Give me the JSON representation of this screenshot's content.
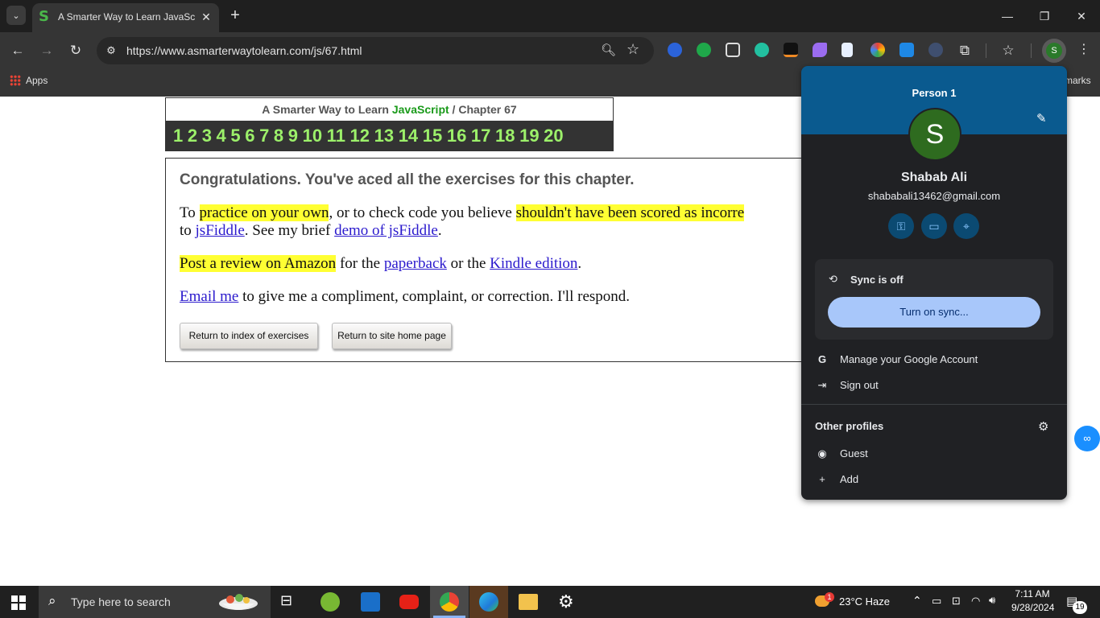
{
  "browser": {
    "tab_title": "A Smarter Way to Learn JavaScript",
    "tab_favicon": "S",
    "url": "https://www.asmarterwaytolearn.com/js/67.html",
    "bookmarks_apps": "Apps",
    "bookmarks_right": "marks",
    "profile_initial": "S"
  },
  "page": {
    "header_prefix": "A Smarter Way to Learn ",
    "header_js": "JavaScript",
    "header_suffix": "  /  Chapter 67",
    "chapters": [
      "1",
      "2",
      "3",
      "4",
      "5",
      "6",
      "7",
      "8",
      "9",
      "10",
      "11",
      "12",
      "13",
      "14",
      "15",
      "16",
      "17",
      "18",
      "19",
      "20"
    ],
    "congrats": "Congratulations. You've aced all the exercises for this chapter.",
    "p1_a": "To ",
    "p1_hl1": "practice on your own",
    "p1_b": ", or to check code you believe ",
    "p1_hl2": "shouldn't have been scored as incorre",
    "p1_c": "to ",
    "p1_link1": "jsFiddle",
    "p1_d": ". See my brief ",
    "p1_link2": "demo of jsFiddle",
    "p1_e": ".",
    "p2_hl": "Post a review on Amazon",
    "p2_a": " for the ",
    "p2_link1": "paperback",
    "p2_b": " or the ",
    "p2_link2": "Kindle edition",
    "p2_c": ".",
    "p3_link": "Email me",
    "p3_a": " to give me a compliment, complaint, or correction. I'll respond.",
    "btn_index": "Return to index of exercises",
    "btn_home": "Return to site home page"
  },
  "profile_menu": {
    "title": "Person 1",
    "avatar_initial": "S",
    "name": "Shabab Ali",
    "email": "shababali13462@gmail.com",
    "sync_status": "Sync is off",
    "sync_button": "Turn on sync...",
    "manage_account": "Manage your Google Account",
    "sign_out": "Sign out",
    "other_profiles": "Other profiles",
    "guest": "Guest",
    "add": "Add"
  },
  "taskbar": {
    "search_placeholder": "Type here to search",
    "weather": "23°C  Haze",
    "time": "7:11 AM",
    "date": "9/28/2024",
    "notification_count": "19",
    "weather_badge": "1"
  },
  "colors": {
    "accent_green": "#1a9a1a",
    "chapter_green": "#9cf06a",
    "highlight": "#ffff33",
    "popup_banner": "#0a5a8f",
    "sync_button": "#a8c7fa"
  }
}
